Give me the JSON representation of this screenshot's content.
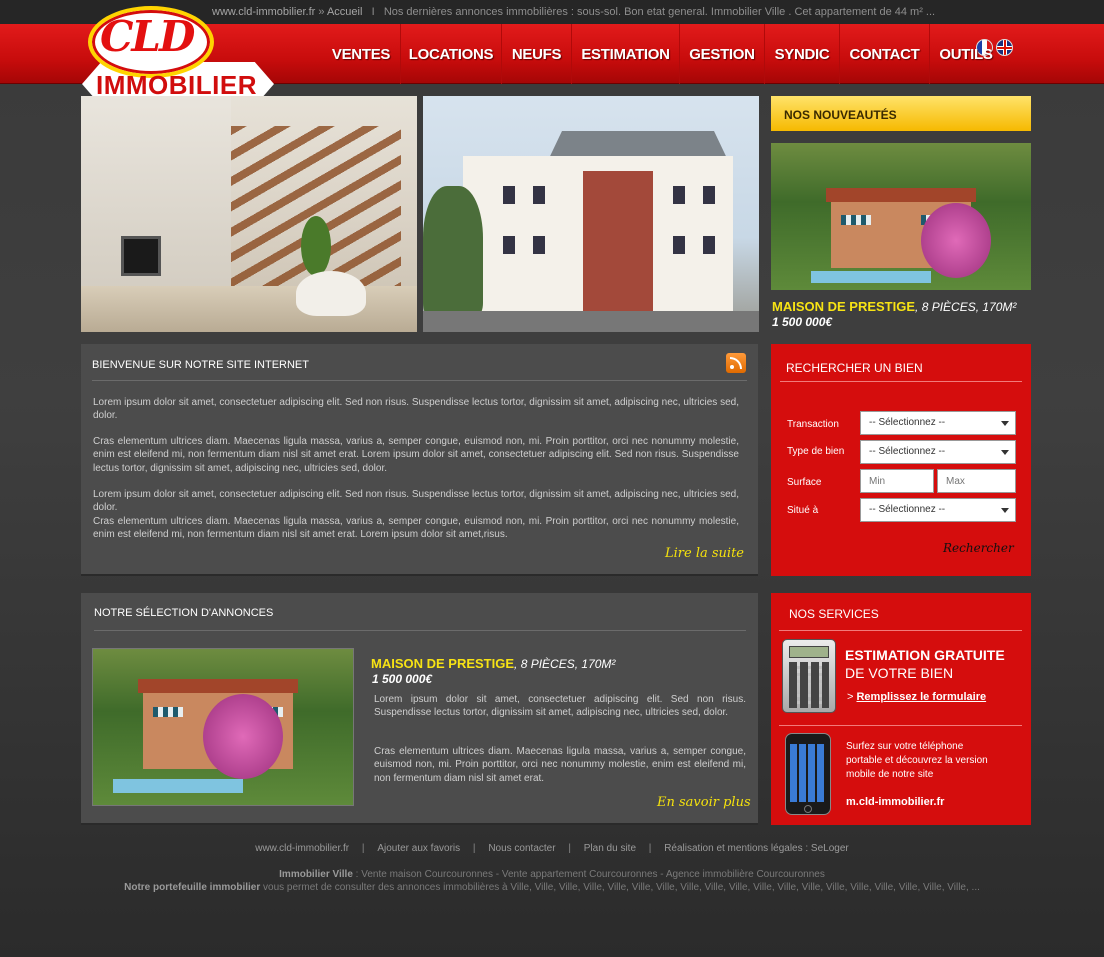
{
  "topbar": {
    "site": "www.cld-immobilier.fr",
    "crumb_sep": "»",
    "crumb_home": "Accueil",
    "pipe": "I",
    "ticker": "Nos dernières annonces immobilières : sous-sol. Bon etat general. Immobilier Ville . Cet appartement de 44 m²   ..."
  },
  "logo": {
    "top": "CLD",
    "bottom": "IMMOBILIER"
  },
  "languages": [
    "fr",
    "en"
  ],
  "menu": [
    "VENTES",
    "LOCATIONS",
    "NEUFS",
    "ESTIMATION",
    "GESTION",
    "SYNDIC",
    "CONTACT",
    "OUTILS"
  ],
  "news": {
    "heading": "NOS NOUVEAUTÉS",
    "title": "MAISON DE PRESTIGE",
    "details": ", 8 PIÈCES, 170M²",
    "price": "1 500 000€"
  },
  "welcome": {
    "heading": "BIENVENUE SUR NOTRE SITE INTERNET",
    "p1": "Lorem ipsum dolor sit amet, consectetuer adipiscing elit. Sed non risus. Suspendisse lectus tortor, dignissim sit amet, adipiscing nec, ultricies sed, dolor.",
    "p2": "Cras elementum ultrices diam. Maecenas ligula massa, varius a, semper congue, euismod non, mi. Proin porttitor, orci nec nonummy molestie, enim est eleifend mi, non fermentum diam nisl sit amet erat. Lorem ipsum dolor sit amet, consectetuer adipiscing elit. Sed non risus. Suspendisse lectus tortor, dignissim sit amet, adipiscing nec, ultricies sed, dolor.",
    "p3": "Lorem ipsum dolor sit amet, consectetuer adipiscing elit. Sed non risus. Suspendisse lectus tortor, dignissim sit amet, adipiscing nec, ultricies sed, dolor.",
    "p4": "Cras elementum ultrices diam. Maecenas ligula massa, varius a, semper congue, euismod non, mi. Proin porttitor, orci nec nonummy molestie, enim est eleifend mi, non fermentum diam nisl sit amet erat. Lorem ipsum dolor sit amet,risus.",
    "more": "Lire la suite"
  },
  "search": {
    "heading": "RECHERCHER UN BIEN",
    "transaction_label": "Transaction",
    "transaction_value": "-- Sélectionnez --",
    "type_label": "Type de bien",
    "type_value": "-- Sélectionnez --",
    "surface_label": "Surface",
    "surface_min": "Min",
    "surface_max": "Max",
    "location_label": "Situé à",
    "location_value": "-- Sélectionnez --",
    "submit": "Rechercher"
  },
  "selection": {
    "heading": "NOTRE SÉLECTION D'ANNONCES",
    "title": "MAISON DE PRESTIGE",
    "details": ", 8 PIÈCES, 170M²",
    "price": "1 500 000€",
    "p1": "Lorem ipsum dolor sit amet, consectetuer adipiscing elit. Sed non risus. Suspendisse lectus tortor, dignissim sit amet, adipiscing nec, ultricies sed, dolor.",
    "p2": "Cras elementum ultrices diam. Maecenas ligula massa, varius a, semper congue, euismod non, mi. Proin porttitor, orci nec nonummy molestie, enim est eleifend mi, non fermentum diam nisl sit amet erat.",
    "more": "En savoir plus"
  },
  "services": {
    "heading": "NOS  SERVICES",
    "est_line1": "ESTIMATION GRATUITE",
    "est_line2": "DE VOTRE BIEN",
    "est_prefix": "> ",
    "est_link": "Remplissez le formulaire",
    "mobile_text": "Surfez sur votre téléphone portable et découvrez la version mobile de notre site",
    "mobile_url": "m.cld-immobilier.fr"
  },
  "footer": {
    "links": [
      "www.cld-immobilier.fr",
      "Ajouter aux favoris",
      "Nous contacter",
      "Plan du site",
      "Réalisation et mentions légales : SeLoger"
    ],
    "sep": "|",
    "line1_bold": "Immobilier Ville",
    "line1_text": " : Vente maison Courcouronnes - Vente appartement Courcouronnes - Agence immobilière Courcouronnes",
    "line2_bold": "Notre portefeuille immobilier",
    "line2_text": " vous permet de consulter des annonces immobilières à  Ville, Ville, Ville, Ville, Ville, Ville, Ville, Ville, Ville, Ville, Ville, Ville, Ville, Ville, Ville, Ville, Ville, Ville, Ville, ..."
  }
}
